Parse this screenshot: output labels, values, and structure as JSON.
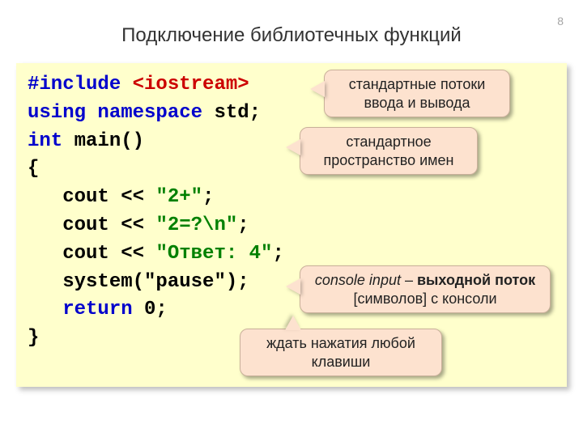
{
  "page_number": "8",
  "title": "Подключение библиотечных функций",
  "code": {
    "l1a": "#include",
    "l1b": "<iostream>",
    "l2a": "using",
    "l2b": "namespace",
    "l2c": "std;",
    "l3a": "int",
    "l3b": "main()",
    "l4": "{",
    "l5a": "   cout << ",
    "l5b": "\"2+\"",
    "l5c": ";",
    "l6a": "   cout << ",
    "l6b": "\"2=?\\n\"",
    "l6c": ";",
    "l7a": "   cout << ",
    "l7b": "\"Ответ: 4\"",
    "l7c": ";",
    "l8": "   system(\"pause\");",
    "l9a": "   return",
    "l9b": "0;",
    "l10": "}"
  },
  "callouts": {
    "c1": "стандартные потоки ввода и вывода",
    "c2": "стандартное пространство имен",
    "c3a": "console input",
    "c3b": " – ",
    "c3c": "выходной поток",
    "c3d": " [символов] с консоли",
    "c4": "ждать нажатия любой клавиши"
  }
}
